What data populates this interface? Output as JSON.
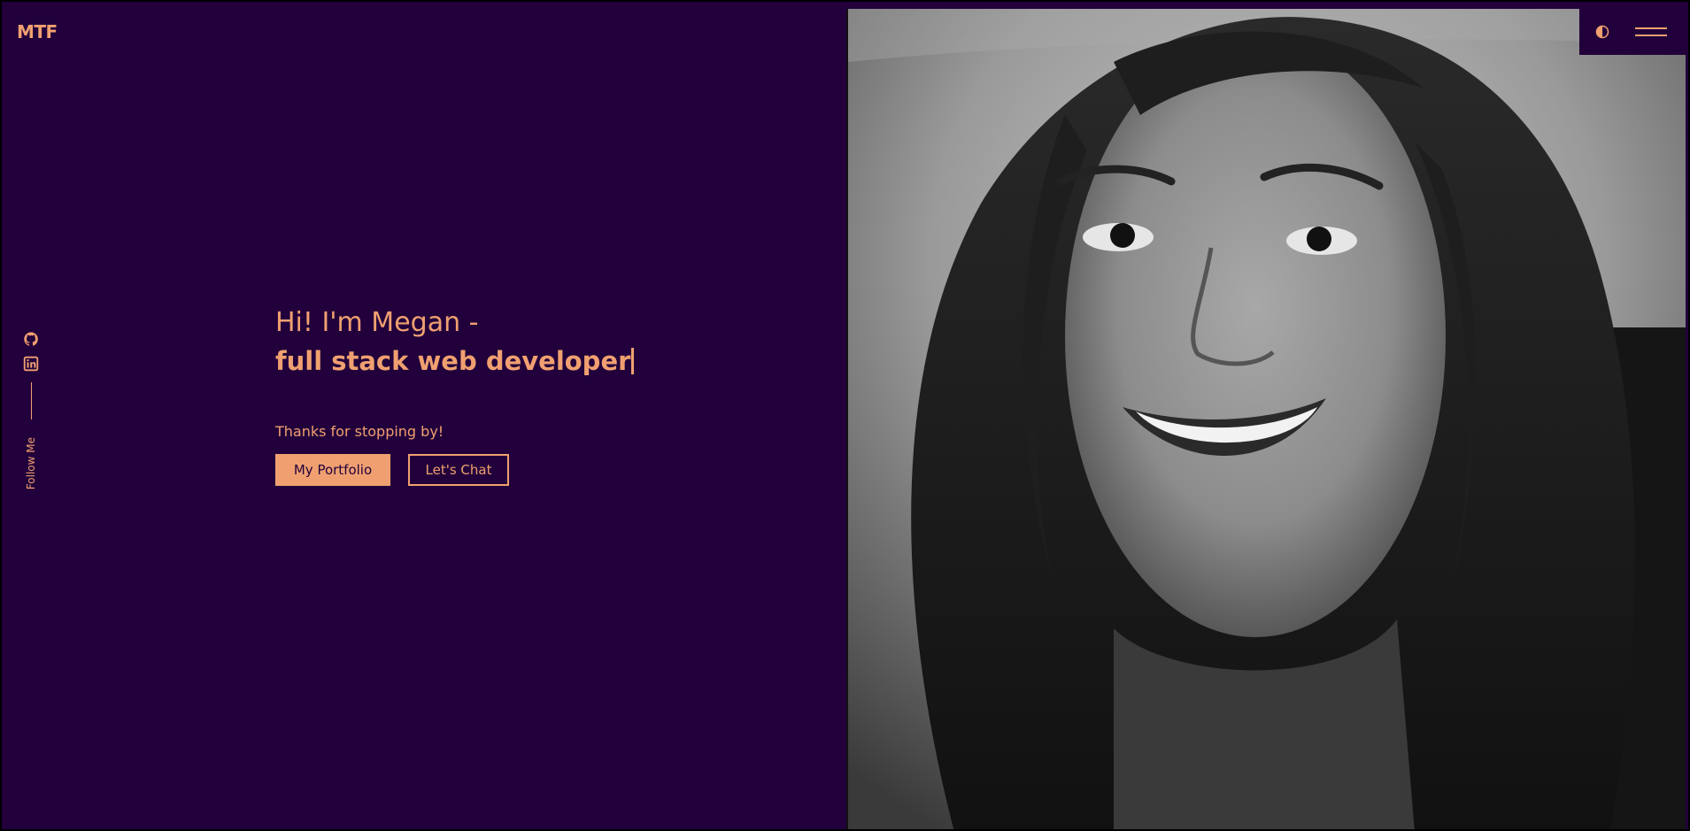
{
  "header": {
    "logo": "MTF"
  },
  "social": {
    "items": [
      {
        "name": "GitHub",
        "icon": "github-icon"
      },
      {
        "name": "LinkedIn",
        "icon": "linkedin-icon"
      }
    ],
    "follow_label": "Follow Me"
  },
  "hero": {
    "greeting": "Hi! I'm Megan -",
    "role": "full stack web developer",
    "tagline": "Thanks for stopping by!",
    "primary_button": "My Portfolio",
    "secondary_button": "Let's Chat"
  },
  "controls": {
    "theme_icon": "half-circle-icon",
    "menu_icon": "hamburger-menu-icon"
  },
  "colors": {
    "background": "#22003b",
    "accent": "#f0a070"
  }
}
